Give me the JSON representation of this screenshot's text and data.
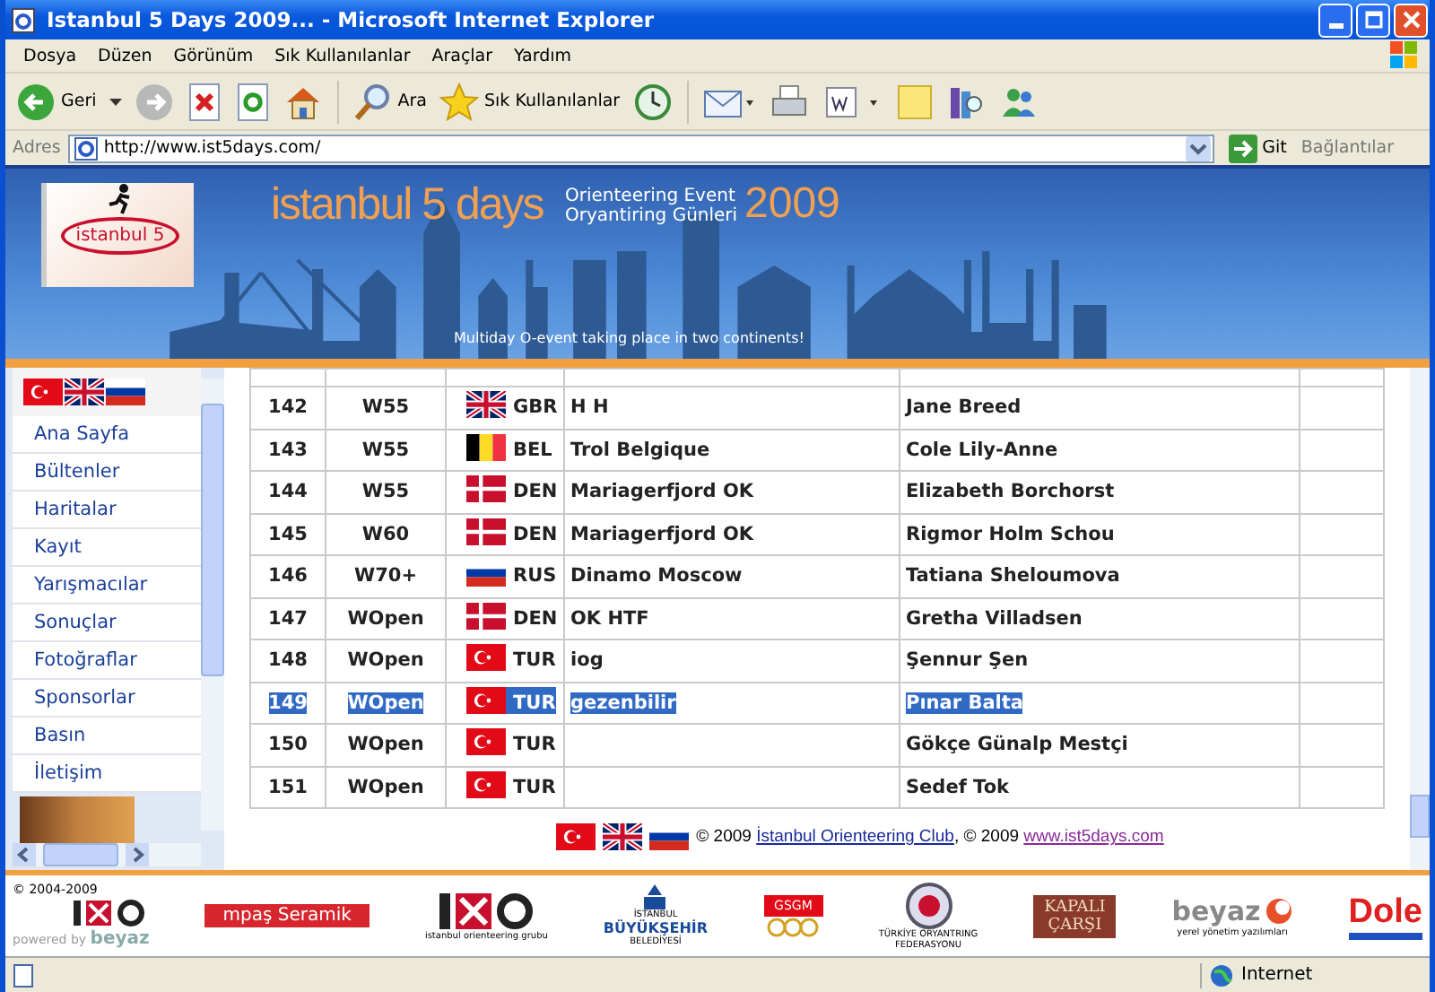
{
  "window": {
    "title": "Istanbul 5 Days 2009... - Microsoft Internet Explorer"
  },
  "menu": [
    "Dosya",
    "Düzen",
    "Görünüm",
    "Sık Kullanılanlar",
    "Araçlar",
    "Yardım"
  ],
  "toolbar": [
    {
      "kind": "back",
      "label": "Geri"
    },
    {
      "kind": "forward"
    },
    {
      "kind": "stop"
    },
    {
      "kind": "refresh"
    },
    {
      "kind": "home"
    },
    {
      "kind": "search",
      "label": "Ara"
    },
    {
      "kind": "favorites",
      "label": "Sık Kullanılanlar"
    },
    {
      "kind": "history"
    },
    {
      "kind": "mail"
    },
    {
      "kind": "print"
    },
    {
      "kind": "edit"
    },
    {
      "kind": "note"
    },
    {
      "kind": "research"
    },
    {
      "kind": "messenger"
    }
  ],
  "address": {
    "label": "Adres",
    "value": "http://www.ist5days.com/",
    "go": "Git",
    "links": "Bağlantılar"
  },
  "banner": {
    "logo_text": "istanbul 5",
    "title": "istanbul 5 days",
    "subtitle_1": "Orienteering Event",
    "subtitle_2": "Oryantiring Günleri",
    "year": "2009",
    "tagline": "Multiday O-event taking place in two continents!"
  },
  "sidebar": {
    "items": [
      "Ana Sayfa",
      "Bültenler",
      "Haritalar",
      "Kayıt",
      "Yarışmacılar",
      "Sonuçlar",
      "Fotoğraflar",
      "Sponsorlar",
      "Basın",
      "İletişim"
    ]
  },
  "table": {
    "rows": [
      {
        "number": "142",
        "class": "W55",
        "kind": "gb",
        "country": "GBR",
        "club": "H H",
        "name": "Jane Breed",
        "selected": false
      },
      {
        "number": "143",
        "class": "W55",
        "kind": "be",
        "country": "BEL",
        "club": "Trol Belgique",
        "name": "Cole Lily-Anne",
        "selected": false
      },
      {
        "number": "144",
        "class": "W55",
        "kind": "dk",
        "country": "DEN",
        "club": "Mariagerfjord OK",
        "name": "Elizabeth Borchorst",
        "selected": false
      },
      {
        "number": "145",
        "class": "W60",
        "kind": "dk",
        "country": "DEN",
        "club": "Mariagerfjord OK",
        "name": "Rigmor Holm Schou",
        "selected": false
      },
      {
        "number": "146",
        "class": "W70+",
        "kind": "ru",
        "country": "RUS",
        "club": "Dinamo Moscow",
        "name": "Tatiana Sheloumova",
        "selected": false
      },
      {
        "number": "147",
        "class": "WOpen",
        "kind": "dk",
        "country": "DEN",
        "club": "OK HTF",
        "name": "Gretha Villadsen",
        "selected": false
      },
      {
        "number": "148",
        "class": "WOpen",
        "kind": "tr",
        "country": "TUR",
        "club": "iog",
        "name": "Şennur Şen",
        "selected": false
      },
      {
        "number": "149",
        "class": "WOpen",
        "kind": "tr",
        "country": "TUR",
        "club": "gezenbilir",
        "name": "Pınar Balta",
        "selected": true
      },
      {
        "number": "150",
        "class": "WOpen",
        "kind": "tr",
        "country": "TUR",
        "club": "",
        "name": "Gökçe Günalp Mestçi",
        "selected": false
      },
      {
        "number": "151",
        "class": "WOpen",
        "kind": "tr",
        "country": "TUR",
        "club": "",
        "name": "Sedef Tok",
        "selected": false
      }
    ]
  },
  "copyright": {
    "prefix": "© 2009",
    "club": "İstanbul Orienteering Club",
    "middle": ", © 2009",
    "site": "www.ist5days.com"
  },
  "sponsors": [
    {
      "kind": "credit",
      "text": "© 2004-2009",
      "powered": "powered by",
      "brand": "beyaz"
    },
    {
      "kind": "ribbon",
      "text": "mpaş Seramik"
    },
    {
      "kind": "iog",
      "caption": "istanbul orienteering grubu"
    },
    {
      "kind": "municipality",
      "lines": [
        "İSTANBUL",
        "BÜYÜKŞEHİR",
        "BELEDİYESİ"
      ]
    },
    {
      "kind": "olympic",
      "text": "GSGM"
    },
    {
      "kind": "federation",
      "lines": [
        "TÜRKİYE ORYANTRING",
        "FEDERASYONU"
      ]
    },
    {
      "kind": "bazaar",
      "lines": [
        "KAPALI",
        "ÇARŞI"
      ]
    },
    {
      "kind": "software",
      "text": "beyaz",
      "caption": "yerel yönetim yazılımları"
    },
    {
      "kind": "fruit",
      "text": "Dole"
    }
  ],
  "status_bar": {
    "zone": "Internet"
  }
}
